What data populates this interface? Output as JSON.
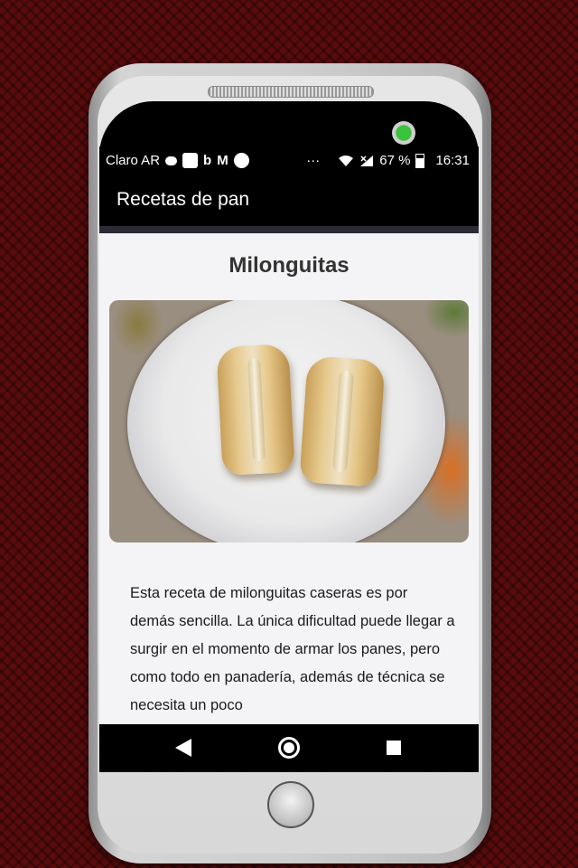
{
  "status_bar": {
    "carrier": "Claro AR",
    "notification_icons": [
      "chat-bubble-icon",
      "square-icon",
      "b-logo-icon",
      "gmail-icon",
      "circle-icon"
    ],
    "more": "···",
    "battery_percent": "67 %",
    "time": "16:31"
  },
  "app_bar": {
    "title": "Recetas de pan"
  },
  "recipe": {
    "title": "Milonguitas",
    "description": "Esta receta de milonguitas caseras es por demás sencilla. La única dificultad puede llegar a surgir en el momento de armar los panes, pero como todo en panadería, además de técnica se necesita un poco"
  },
  "nav_bar": {
    "icons": [
      "back-icon",
      "home-icon",
      "recents-icon"
    ]
  },
  "colors": {
    "background": "#5a0c0c",
    "bar": "#000000",
    "screen": "#f4f4f6",
    "camera_led": "#3cc23c"
  }
}
